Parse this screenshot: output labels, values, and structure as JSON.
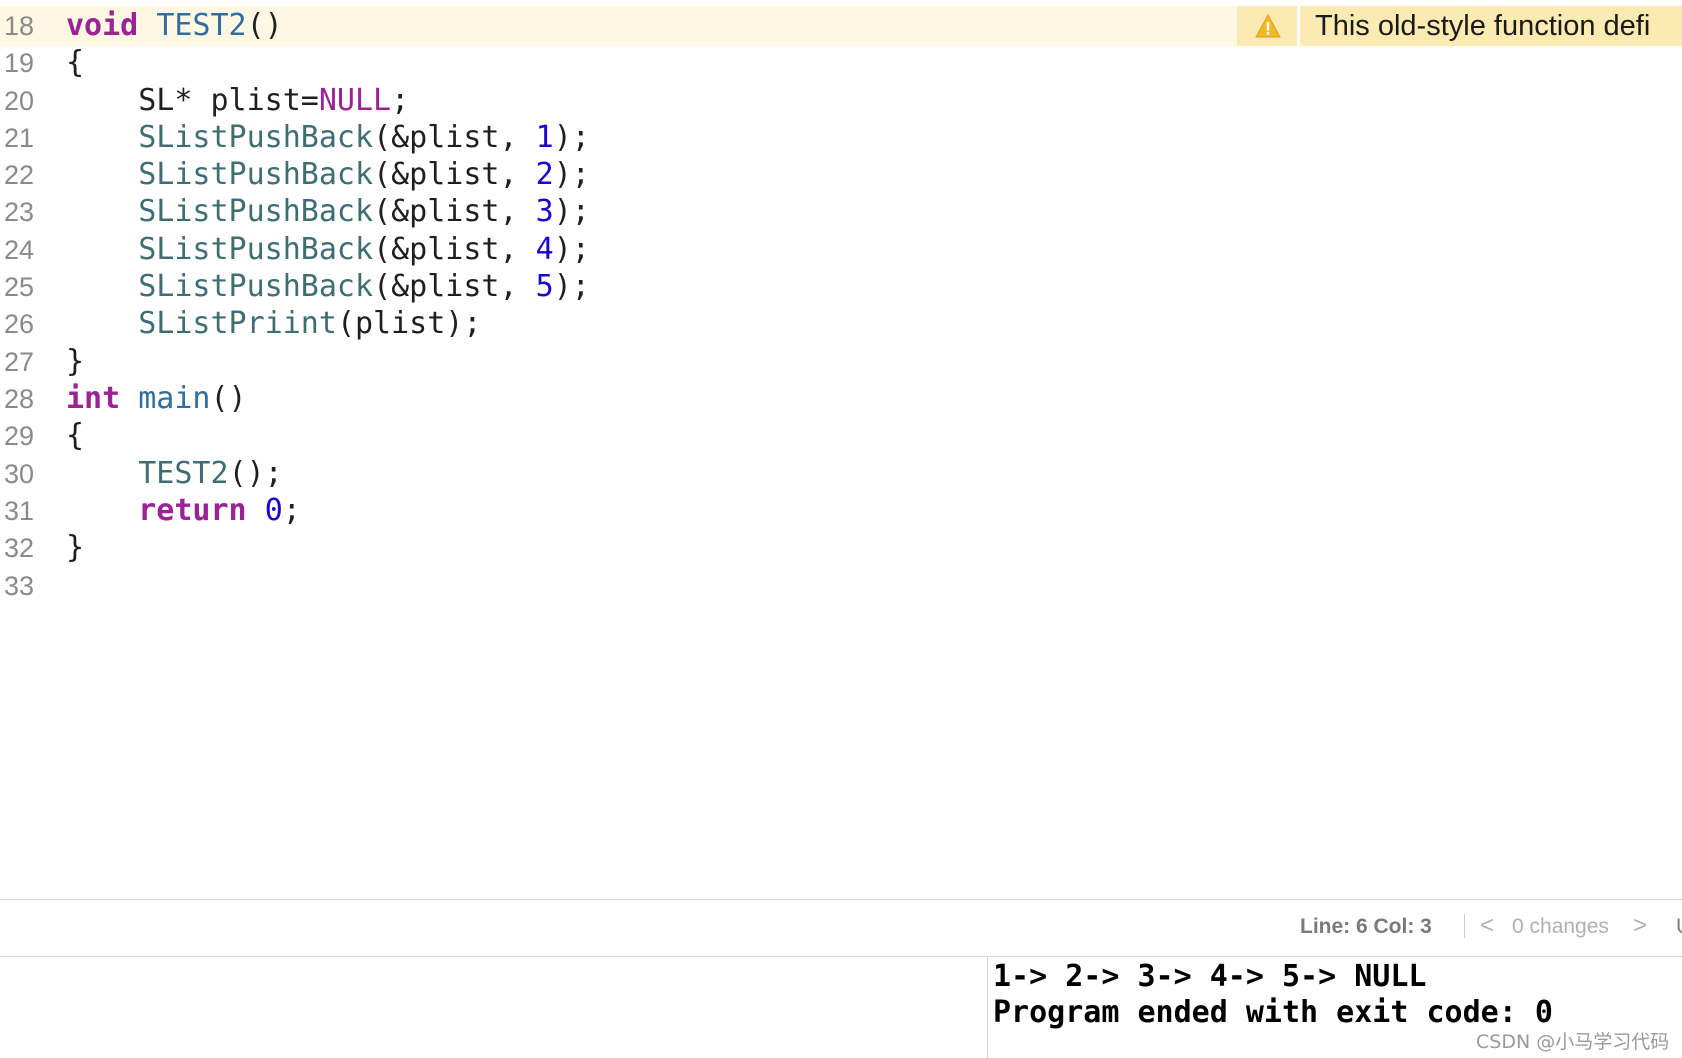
{
  "editor": {
    "line_numbers": [
      "18",
      "19",
      "20",
      "21",
      "22",
      "23",
      "24",
      "25",
      "26",
      "27",
      "28",
      "29",
      "30",
      "31",
      "32",
      "33"
    ],
    "lines": {
      "l18": {
        "kw": "void",
        "fn": "TEST2",
        "punct": "()"
      },
      "l19": {
        "text": "{"
      },
      "l20": {
        "type": "SL* plist=",
        "macro": "NULL",
        "end": ";"
      },
      "l21": {
        "fn": "SListPushBack",
        "args": "(&plist, ",
        "num": "1",
        "end": ");"
      },
      "l22": {
        "fn": "SListPushBack",
        "args": "(&plist, ",
        "num": "2",
        "end": ");"
      },
      "l23": {
        "fn": "SListPushBack",
        "args": "(&plist, ",
        "num": "3",
        "end": ");"
      },
      "l24": {
        "fn": "SListPushBack",
        "args": "(&plist, ",
        "num": "4",
        "end": ");"
      },
      "l25": {
        "fn": "SListPushBack",
        "args": "(&plist, ",
        "num": "5",
        "end": ");"
      },
      "l26": {
        "fn": "SListPriint",
        "args": "(plist);"
      },
      "l27": {
        "text": "}"
      },
      "l28": {
        "kw": "int",
        "fn": "main",
        "punct": "()"
      },
      "l29": {
        "text": "{"
      },
      "l30": {
        "fn": "TEST2",
        "args": "();"
      },
      "l31": {
        "kw": "return",
        "num": "0",
        "end": ";"
      },
      "l32": {
        "text": "}"
      }
    }
  },
  "warning": {
    "icon": "warning-triangle-icon",
    "text": "This old-style function defi"
  },
  "status_bar": {
    "position": "Line: 6  Col: 3",
    "prev": "<",
    "changes": "0 changes",
    "next": ">",
    "edge": "U"
  },
  "console": {
    "lines": [
      "1-> 2-> 3-> 4-> 5-> NULL",
      "Program ended with exit code: 0"
    ]
  },
  "watermark": "CSDN @小马学习代码",
  "colors": {
    "keyword": "#9b2393",
    "function": "#3e6d74",
    "number": "#1c00cf",
    "warning_bg": "#fbeab2",
    "current_line_bg": "#fdf7e3"
  }
}
